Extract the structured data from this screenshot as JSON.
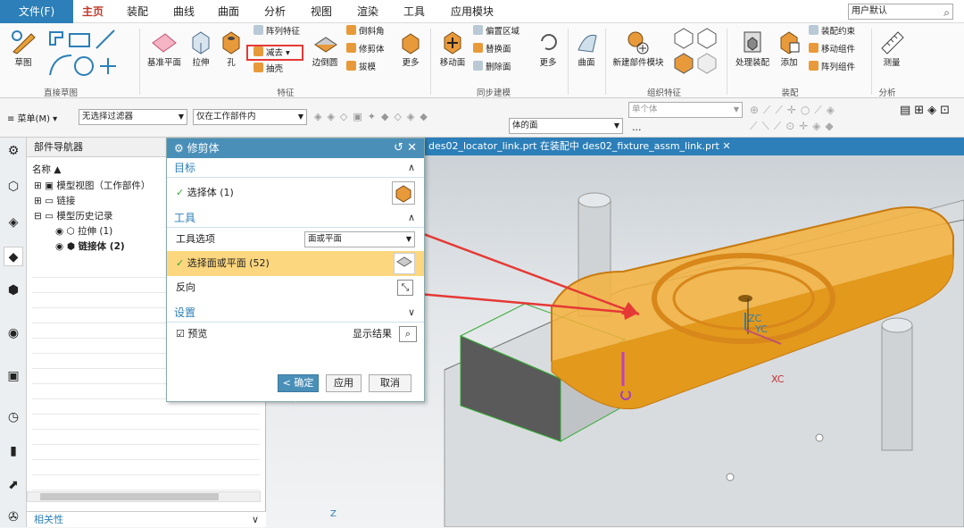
{
  "menu": {
    "file": "文件(F)",
    "tabs": [
      "主页",
      "装配",
      "曲线",
      "曲面",
      "分析",
      "视图",
      "渲染",
      "工具",
      "应用模块"
    ],
    "role": "用户默认"
  },
  "ribbon": {
    "sketch": "草图",
    "direct_sketch": "直接草图",
    "datum_plane": "基准平面",
    "extrude": "拉伸",
    "hole": "孔",
    "pattern_feature": "阵列特征",
    "subtract": "减去",
    "shell": "抽壳",
    "edge_blend": "边倒圆",
    "chamfer": "倒斜角",
    "trim_body": "修剪体",
    "draft": "拔模",
    "more1": "更多",
    "feature": "特征",
    "move_face": "移动面",
    "offset_region": "偏置区域",
    "replace_face": "替换面",
    "delete_face": "删除面",
    "more2": "更多",
    "sync": "同步建模",
    "surface": "曲面",
    "new_component": "新建部件模块",
    "wave": "组织特征",
    "handle_asm": "处理装配",
    "add": "添加",
    "asm_constraint": "装配约束",
    "move_comp": "移动组件",
    "pattern_comp": "阵列组件",
    "assembly": "装配",
    "measure": "测量",
    "analysis": "分析"
  },
  "filter": {
    "menu": "菜单(M)",
    "no_filter": "无选择过滤器",
    "work_only": "仅在工作部件内",
    "body_faces": "体的面",
    "single_body": "单个体",
    "dots": "..."
  },
  "navigator": {
    "title": "部件导航器",
    "col_name": "名称",
    "model_view": "模型视图（工作部件）",
    "links": "链接",
    "history": "模型历史记录",
    "extrude1": "拉伸 (1)",
    "link_body": "链接体 (2)",
    "related": "相关性"
  },
  "viewport": {
    "tab": "des02_locator_link.prt 在装配中 des02_fixture_assm_link.prt"
  },
  "dialog": {
    "title": "修剪体",
    "target": "目标",
    "select_body": "选择体 (1)",
    "tool": "工具",
    "tool_option": "工具选项",
    "tool_option_value": "面或平面",
    "select_face": "选择面或平面 (52)",
    "reverse": "反向",
    "settings": "设置",
    "preview": "预览",
    "show_result": "显示结果",
    "ok": "< 确定 >",
    "apply": "应用",
    "cancel": "取消"
  },
  "axes": {
    "zc": "ZC",
    "yc": "YC",
    "xc": "XC",
    "z": "Z"
  }
}
